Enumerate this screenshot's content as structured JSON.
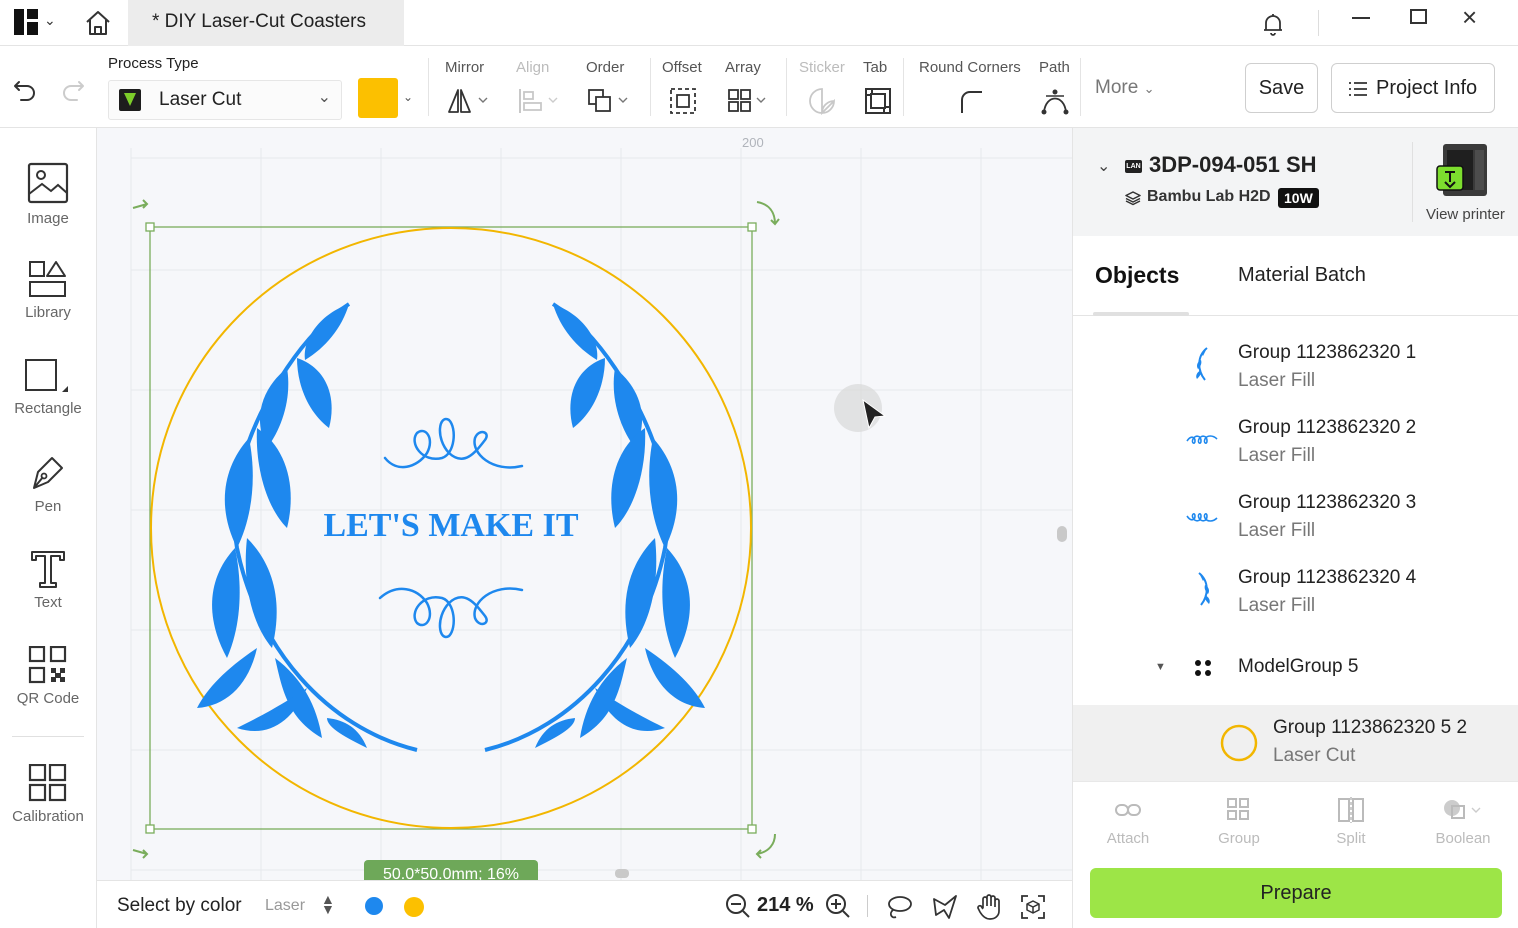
{
  "titlebar": {
    "doc_tab_title": "* DIY Laser-Cut Coasters"
  },
  "toolbar": {
    "process_type_label": "Process Type",
    "process_type_value": "Laser Cut",
    "color_value": "#fcc000",
    "tools": [
      {
        "label": "Mirror",
        "icon": "mirror-icon",
        "enabled": true
      },
      {
        "label": "Align",
        "icon": "align-icon",
        "enabled": false
      },
      {
        "label": "Order",
        "icon": "order-icon",
        "enabled": true
      },
      {
        "label": "Offset",
        "icon": "offset-icon",
        "enabled": true
      },
      {
        "label": "Array",
        "icon": "array-icon",
        "enabled": true
      },
      {
        "label": "Sticker",
        "icon": "sticker-icon",
        "enabled": false
      },
      {
        "label": "Tab",
        "icon": "tab-icon",
        "enabled": true
      },
      {
        "label": "Round Corners",
        "icon": "round-corners-icon",
        "enabled": true
      },
      {
        "label": "Path",
        "icon": "path-icon",
        "enabled": true
      }
    ],
    "more_label": "More",
    "save_label": "Save",
    "project_info_label": "Project Info"
  },
  "sidebar": {
    "items": [
      {
        "label": "Image",
        "icon": "image-icon"
      },
      {
        "label": "Library",
        "icon": "library-icon"
      },
      {
        "label": "Rectangle",
        "icon": "rectangle-icon"
      },
      {
        "label": "Pen",
        "icon": "pen-icon"
      },
      {
        "label": "Text",
        "icon": "text-icon"
      },
      {
        "label": "QR Code",
        "icon": "qr-code-icon"
      },
      {
        "label": "Calibration",
        "icon": "calibration-icon"
      }
    ]
  },
  "canvas": {
    "ruler_label": "200",
    "design_text": "LET'S MAKE IT",
    "dimensions_badge": "50.0*50.0mm; 16%",
    "colors": {
      "fill": "#1e88ee",
      "cut": "#f2b600",
      "selection": "#7aad5c"
    }
  },
  "bottombar": {
    "select_by_color_label": "Select by color",
    "laser_filter": "Laser",
    "color_dots": [
      "#1e88ee",
      "#fcc000"
    ],
    "zoom": "214 %"
  },
  "rightpanel": {
    "printer": {
      "connection": "LAN",
      "name": "3DP-094-051 SH",
      "model": "Bambu Lab H2D",
      "power": "10W",
      "view_printer_label": "View printer"
    },
    "tabs": {
      "objects": "Objects",
      "material_batch": "Material Batch"
    },
    "objects": [
      {
        "name": "Group 1123862320 1",
        "type": "Laser Fill"
      },
      {
        "name": "Group 1123862320 2",
        "type": "Laser Fill"
      },
      {
        "name": "Group 1123862320 3",
        "type": "Laser Fill"
      },
      {
        "name": "Group 1123862320 4",
        "type": "Laser Fill"
      },
      {
        "name": "ModelGroup 5",
        "type": ""
      },
      {
        "name": "Group 1123862320 5 2",
        "type": "Laser Cut"
      }
    ],
    "actions": [
      {
        "label": "Attach",
        "icon": "attach-icon"
      },
      {
        "label": "Group",
        "icon": "group-icon"
      },
      {
        "label": "Split",
        "icon": "split-icon"
      },
      {
        "label": "Boolean",
        "icon": "boolean-icon"
      }
    ],
    "prepare_label": "Prepare"
  }
}
